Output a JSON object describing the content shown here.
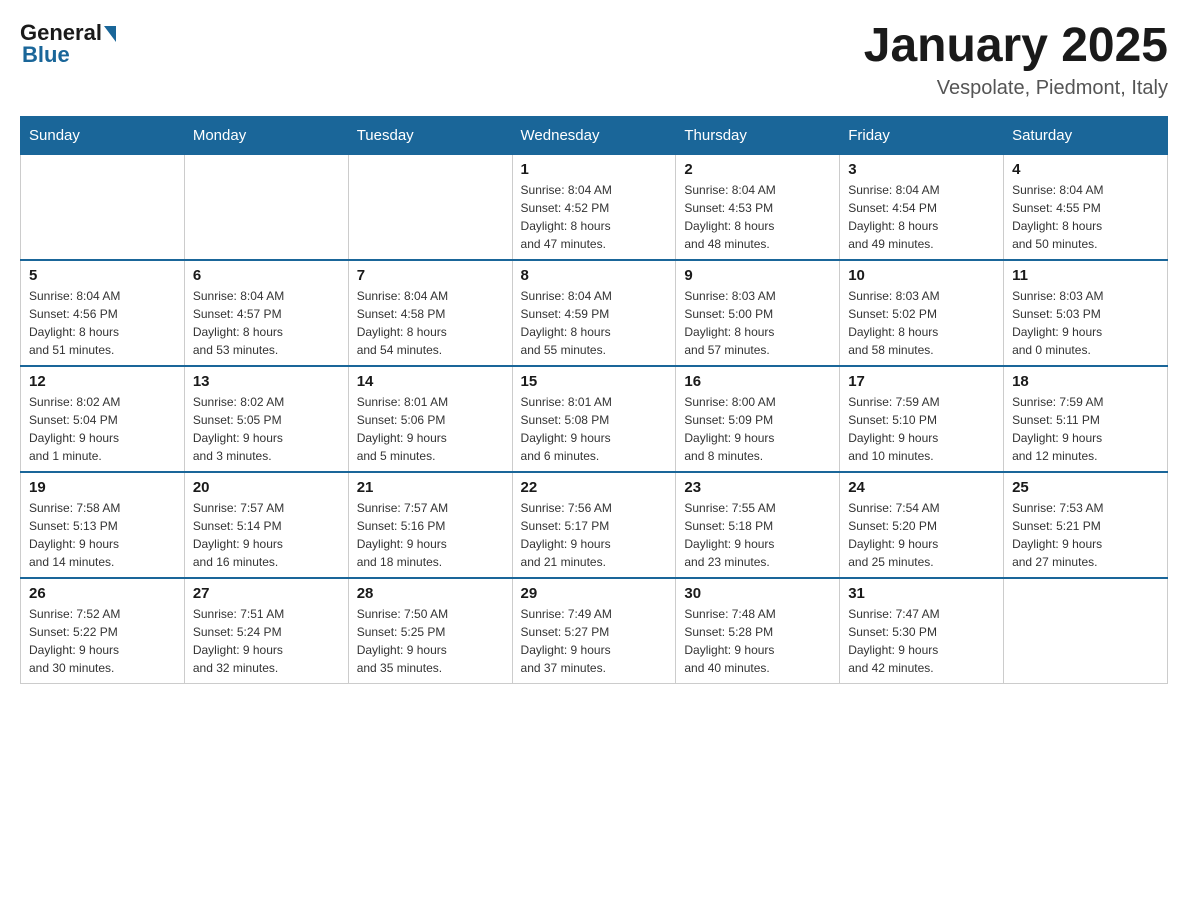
{
  "header": {
    "logo_general": "General",
    "logo_blue": "Blue",
    "title": "January 2025",
    "subtitle": "Vespolate, Piedmont, Italy"
  },
  "days_of_week": [
    "Sunday",
    "Monday",
    "Tuesday",
    "Wednesday",
    "Thursday",
    "Friday",
    "Saturday"
  ],
  "weeks": [
    [
      {
        "day": "",
        "info": ""
      },
      {
        "day": "",
        "info": ""
      },
      {
        "day": "",
        "info": ""
      },
      {
        "day": "1",
        "info": "Sunrise: 8:04 AM\nSunset: 4:52 PM\nDaylight: 8 hours\nand 47 minutes."
      },
      {
        "day": "2",
        "info": "Sunrise: 8:04 AM\nSunset: 4:53 PM\nDaylight: 8 hours\nand 48 minutes."
      },
      {
        "day": "3",
        "info": "Sunrise: 8:04 AM\nSunset: 4:54 PM\nDaylight: 8 hours\nand 49 minutes."
      },
      {
        "day": "4",
        "info": "Sunrise: 8:04 AM\nSunset: 4:55 PM\nDaylight: 8 hours\nand 50 minutes."
      }
    ],
    [
      {
        "day": "5",
        "info": "Sunrise: 8:04 AM\nSunset: 4:56 PM\nDaylight: 8 hours\nand 51 minutes."
      },
      {
        "day": "6",
        "info": "Sunrise: 8:04 AM\nSunset: 4:57 PM\nDaylight: 8 hours\nand 53 minutes."
      },
      {
        "day": "7",
        "info": "Sunrise: 8:04 AM\nSunset: 4:58 PM\nDaylight: 8 hours\nand 54 minutes."
      },
      {
        "day": "8",
        "info": "Sunrise: 8:04 AM\nSunset: 4:59 PM\nDaylight: 8 hours\nand 55 minutes."
      },
      {
        "day": "9",
        "info": "Sunrise: 8:03 AM\nSunset: 5:00 PM\nDaylight: 8 hours\nand 57 minutes."
      },
      {
        "day": "10",
        "info": "Sunrise: 8:03 AM\nSunset: 5:02 PM\nDaylight: 8 hours\nand 58 minutes."
      },
      {
        "day": "11",
        "info": "Sunrise: 8:03 AM\nSunset: 5:03 PM\nDaylight: 9 hours\nand 0 minutes."
      }
    ],
    [
      {
        "day": "12",
        "info": "Sunrise: 8:02 AM\nSunset: 5:04 PM\nDaylight: 9 hours\nand 1 minute."
      },
      {
        "day": "13",
        "info": "Sunrise: 8:02 AM\nSunset: 5:05 PM\nDaylight: 9 hours\nand 3 minutes."
      },
      {
        "day": "14",
        "info": "Sunrise: 8:01 AM\nSunset: 5:06 PM\nDaylight: 9 hours\nand 5 minutes."
      },
      {
        "day": "15",
        "info": "Sunrise: 8:01 AM\nSunset: 5:08 PM\nDaylight: 9 hours\nand 6 minutes."
      },
      {
        "day": "16",
        "info": "Sunrise: 8:00 AM\nSunset: 5:09 PM\nDaylight: 9 hours\nand 8 minutes."
      },
      {
        "day": "17",
        "info": "Sunrise: 7:59 AM\nSunset: 5:10 PM\nDaylight: 9 hours\nand 10 minutes."
      },
      {
        "day": "18",
        "info": "Sunrise: 7:59 AM\nSunset: 5:11 PM\nDaylight: 9 hours\nand 12 minutes."
      }
    ],
    [
      {
        "day": "19",
        "info": "Sunrise: 7:58 AM\nSunset: 5:13 PM\nDaylight: 9 hours\nand 14 minutes."
      },
      {
        "day": "20",
        "info": "Sunrise: 7:57 AM\nSunset: 5:14 PM\nDaylight: 9 hours\nand 16 minutes."
      },
      {
        "day": "21",
        "info": "Sunrise: 7:57 AM\nSunset: 5:16 PM\nDaylight: 9 hours\nand 18 minutes."
      },
      {
        "day": "22",
        "info": "Sunrise: 7:56 AM\nSunset: 5:17 PM\nDaylight: 9 hours\nand 21 minutes."
      },
      {
        "day": "23",
        "info": "Sunrise: 7:55 AM\nSunset: 5:18 PM\nDaylight: 9 hours\nand 23 minutes."
      },
      {
        "day": "24",
        "info": "Sunrise: 7:54 AM\nSunset: 5:20 PM\nDaylight: 9 hours\nand 25 minutes."
      },
      {
        "day": "25",
        "info": "Sunrise: 7:53 AM\nSunset: 5:21 PM\nDaylight: 9 hours\nand 27 minutes."
      }
    ],
    [
      {
        "day": "26",
        "info": "Sunrise: 7:52 AM\nSunset: 5:22 PM\nDaylight: 9 hours\nand 30 minutes."
      },
      {
        "day": "27",
        "info": "Sunrise: 7:51 AM\nSunset: 5:24 PM\nDaylight: 9 hours\nand 32 minutes."
      },
      {
        "day": "28",
        "info": "Sunrise: 7:50 AM\nSunset: 5:25 PM\nDaylight: 9 hours\nand 35 minutes."
      },
      {
        "day": "29",
        "info": "Sunrise: 7:49 AM\nSunset: 5:27 PM\nDaylight: 9 hours\nand 37 minutes."
      },
      {
        "day": "30",
        "info": "Sunrise: 7:48 AM\nSunset: 5:28 PM\nDaylight: 9 hours\nand 40 minutes."
      },
      {
        "day": "31",
        "info": "Sunrise: 7:47 AM\nSunset: 5:30 PM\nDaylight: 9 hours\nand 42 minutes."
      },
      {
        "day": "",
        "info": ""
      }
    ]
  ]
}
